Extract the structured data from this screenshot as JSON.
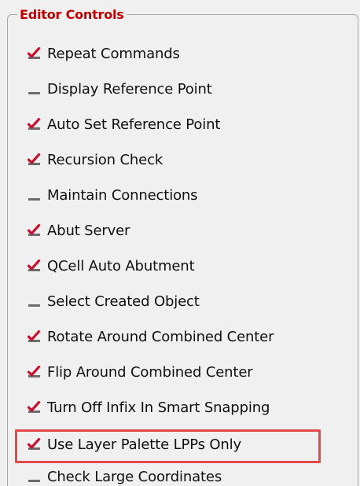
{
  "group": {
    "title": "Editor Controls"
  },
  "options": [
    {
      "label": "Repeat Commands",
      "checked": true
    },
    {
      "label": "Display Reference Point",
      "checked": false
    },
    {
      "label": "Auto Set Reference Point",
      "checked": true
    },
    {
      "label": "Recursion Check",
      "checked": true
    },
    {
      "label": "Maintain Connections",
      "checked": false
    },
    {
      "label": "Abut Server",
      "checked": true
    },
    {
      "label": "QCell Auto Abutment",
      "checked": true
    },
    {
      "label": "Select Created Object",
      "checked": false
    },
    {
      "label": "Rotate Around Combined Center",
      "checked": true
    },
    {
      "label": "Flip Around Combined Center",
      "checked": true
    },
    {
      "label": "Turn Off Infix In Smart Snapping",
      "checked": true
    },
    {
      "label": "Use Layer Palette LPPs Only",
      "checked": true
    },
    {
      "label": "Check Large Coordinates",
      "checked": false
    }
  ],
  "colors": {
    "title": "#c00000",
    "check": "#c8102e",
    "highlight": "#e24a4a"
  }
}
